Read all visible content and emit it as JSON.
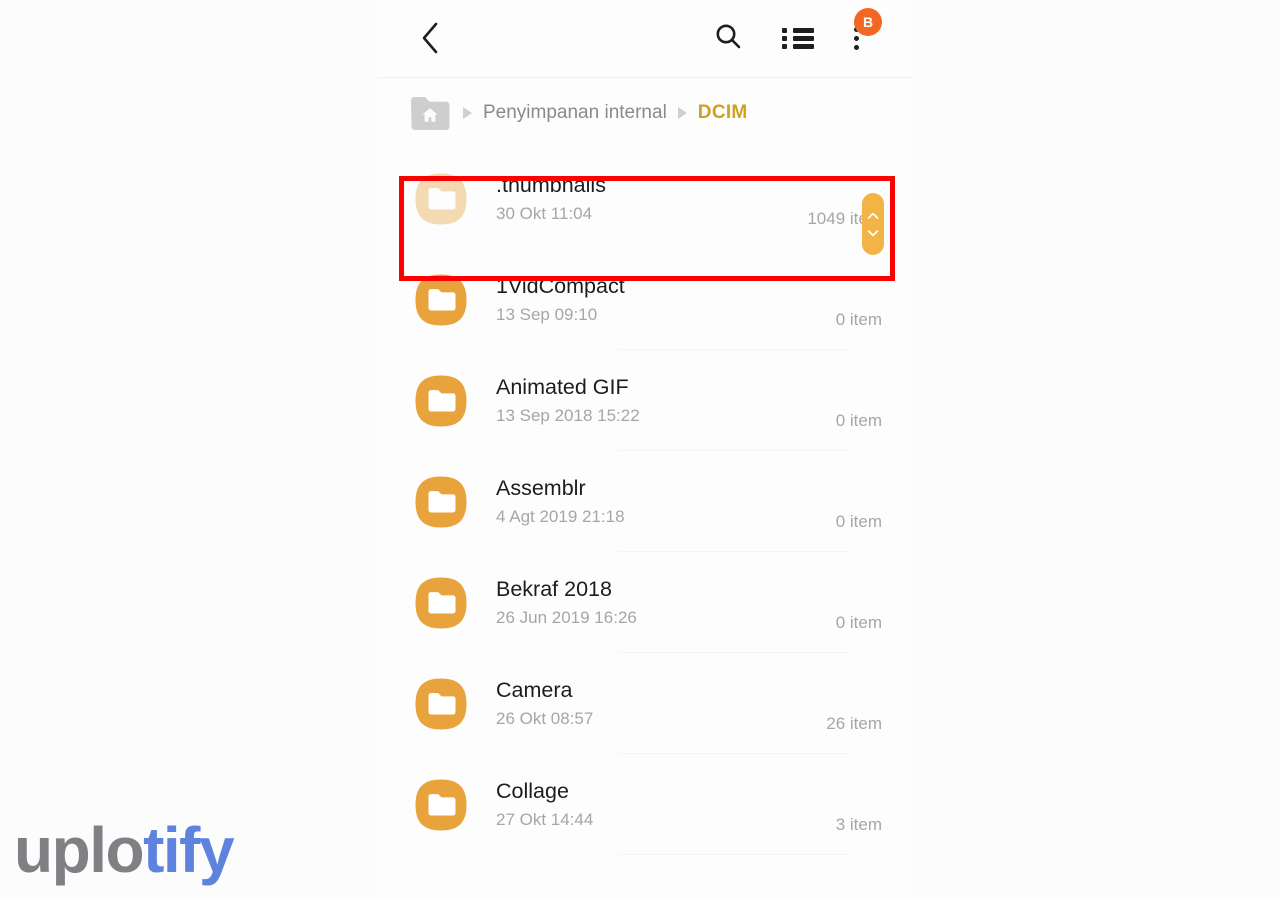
{
  "appbar": {
    "back_icon": "chevron-left-icon",
    "search_icon": "search-icon",
    "listview_icon": "list-view-icon",
    "more_icon": "more-vertical-icon",
    "badge_label": "B",
    "badge_color": "#F26722"
  },
  "breadcrumb": {
    "home_icon": "home-folder-icon",
    "items": [
      {
        "label": "Penyimpanan internal",
        "active": false
      },
      {
        "label": "DCIM",
        "active": true
      }
    ],
    "active_color": "#CFA022",
    "inactive_color": "#8A8A8A"
  },
  "list": {
    "folder_icon": "folder-icon",
    "accent_color": "#E8A33D",
    "rows": [
      {
        "name": ".thumbnails",
        "date": "30 Okt 11:04",
        "count": "1049 item",
        "faded": true,
        "highlighted": true
      },
      {
        "name": "1VidCompact",
        "date": "13 Sep 09:10",
        "count": "0 item",
        "faded": false,
        "highlighted": false
      },
      {
        "name": "Animated GIF",
        "date": "13 Sep 2018 15:22",
        "count": "0 item",
        "faded": false,
        "highlighted": false
      },
      {
        "name": "Assemblr",
        "date": "4 Agt 2019 21:18",
        "count": "0 item",
        "faded": false,
        "highlighted": false
      },
      {
        "name": "Bekraf 2018",
        "date": "26 Jun 2019 16:26",
        "count": "0 item",
        "faded": false,
        "highlighted": false
      },
      {
        "name": "Camera",
        "date": "26 Okt 08:57",
        "count": "26 item",
        "faded": false,
        "highlighted": false
      },
      {
        "name": "Collage",
        "date": "27 Okt 14:44",
        "count": "3 item",
        "faded": false,
        "highlighted": false
      }
    ]
  },
  "scrollbar": {
    "handle_icon": "scroll-handle-chevrons",
    "color": "#F2B447"
  },
  "annotation": {
    "highlight_color": "#FF0000"
  },
  "watermark": {
    "part_a": "uplo",
    "part_b": "tify",
    "color_a": "#7E8084",
    "color_b": "#5E83DE"
  }
}
